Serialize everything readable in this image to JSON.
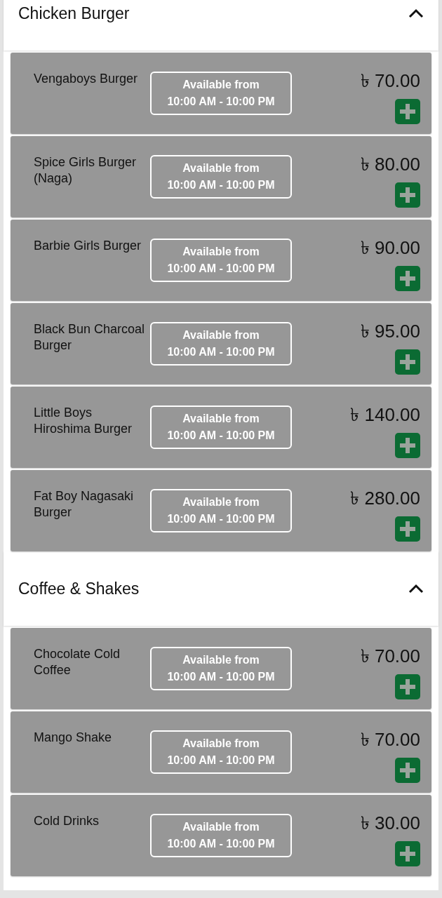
{
  "sections": [
    {
      "title": "Chicken Burger",
      "expanded": true,
      "items": [
        {
          "name": "Vengaboys Burger",
          "price": "৳ 70.00",
          "availability_label": "Available from",
          "availability_hours": "10:00 AM - 10:00 PM"
        },
        {
          "name": "Spice Girls Burger (Naga)",
          "price": "৳ 80.00",
          "availability_label": "Available from",
          "availability_hours": "10:00 AM - 10:00 PM"
        },
        {
          "name": "Barbie Girls Burger",
          "price": "৳ 90.00",
          "availability_label": "Available from",
          "availability_hours": "10:00 AM - 10:00 PM"
        },
        {
          "name": "Black Bun Charcoal Burger",
          "price": "৳ 95.00",
          "availability_label": "Available from",
          "availability_hours": "10:00 AM - 10:00 PM"
        },
        {
          "name": "Little Boys Hiroshima Burger",
          "price": "৳ 140.00",
          "availability_label": "Available from",
          "availability_hours": "10:00 AM - 10:00 PM"
        },
        {
          "name": "Fat Boy Nagasaki Burger",
          "price": "৳ 280.00",
          "availability_label": "Available from",
          "availability_hours": "10:00 AM - 10:00 PM"
        }
      ]
    },
    {
      "title": "Coffee & Shakes",
      "expanded": true,
      "items": [
        {
          "name": "Chocolate Cold Coffee",
          "price": "৳ 70.00",
          "availability_label": "Available from",
          "availability_hours": "10:00 AM - 10:00 PM"
        },
        {
          "name": "Mango Shake",
          "price": "৳ 70.00",
          "availability_label": "Available from",
          "availability_hours": "10:00 AM - 10:00 PM"
        },
        {
          "name": "Cold Drinks",
          "price": "৳ 30.00",
          "availability_label": "Available from",
          "availability_hours": "10:00 AM - 10:00 PM"
        }
      ]
    }
  ]
}
